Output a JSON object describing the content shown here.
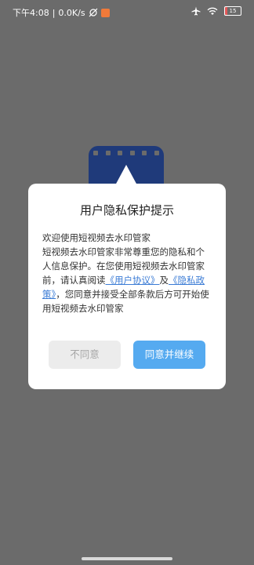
{
  "status_bar": {
    "time": "下午4:08",
    "separator": "|",
    "network_speed": "0.0K/s",
    "battery_level": "15",
    "icons": [
      "mute-icon",
      "notification-icon",
      "airplane-icon",
      "wifi-icon",
      "battery-icon"
    ]
  },
  "dialog": {
    "title": "用户隐私保护提示",
    "intro": "欢迎使用短视频去水印管家",
    "body_before_link": "短视频去水印管家非常尊重您的隐私和个人信息保护。在您使用短视频去水印管家前，请认真阅读",
    "user_agreement_link": "《用户协议》",
    "and_text": "及",
    "privacy_policy_link": "《隐私政策》",
    "body_after_link": "，您同意并接受全部条款后方可开始使用短视频去水印管家",
    "disagree_button": "不同意",
    "agree_button": "同意并继续"
  },
  "colors": {
    "background": "#6b6b6b",
    "link": "#3a7bd5",
    "agree_button": "#55aaf0",
    "disagree_button": "#ececec",
    "app_icon": "#1f3a7a"
  }
}
